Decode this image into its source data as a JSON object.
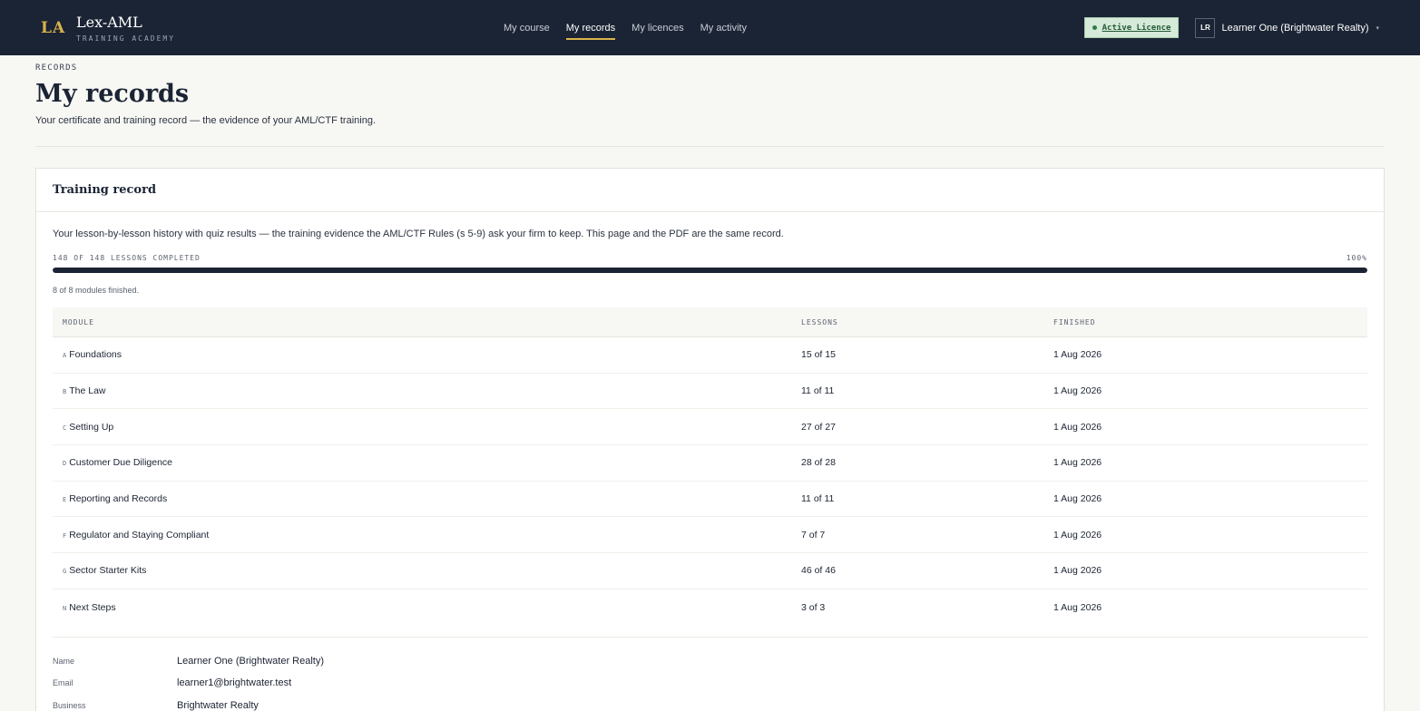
{
  "brand": {
    "mark": "LA",
    "name": "Lex-AML",
    "subtitle": "TRAINING ACADEMY"
  },
  "nav": [
    {
      "label": "My course",
      "active": false
    },
    {
      "label": "My records",
      "active": true
    },
    {
      "label": "My licences",
      "active": false
    },
    {
      "label": "My activity",
      "active": false
    }
  ],
  "licence_badge": {
    "label": "Active Licence",
    "color": "#2f7a46"
  },
  "user": {
    "initials": "LR",
    "name": "Learner One (Brightwater Realty)",
    "caret": "▾"
  },
  "page": {
    "eyebrow": "RECORDS",
    "title": "My records",
    "subtitle": "Your certificate and training record — the evidence of your AML/CTF training."
  },
  "training_record": {
    "title": "Training record",
    "intro": "Your lesson-by-lesson history with quiz results — the training evidence the AML/CTF Rules (s 5-9) ask your firm to keep. This page and the PDF are the same record.",
    "progress_label": "148 OF 148 LESSONS COMPLETED",
    "progress_pct": "100%",
    "progress_fraction": 1.0,
    "modules_note": "8 of 8 modules finished.",
    "columns": {
      "module": "MODULE",
      "lessons": "LESSONS",
      "finished": "FINISHED"
    },
    "rows": [
      {
        "letter": "A",
        "module": "Foundations",
        "lessons": "15 of 15",
        "finished": "1 Aug 2026"
      },
      {
        "letter": "B",
        "module": "The Law",
        "lessons": "11 of 11",
        "finished": "1 Aug 2026"
      },
      {
        "letter": "C",
        "module": "Setting Up",
        "lessons": "27 of 27",
        "finished": "1 Aug 2026"
      },
      {
        "letter": "D",
        "module": "Customer Due Diligence",
        "lessons": "28 of 28",
        "finished": "1 Aug 2026"
      },
      {
        "letter": "E",
        "module": "Reporting and Records",
        "lessons": "11 of 11",
        "finished": "1 Aug 2026"
      },
      {
        "letter": "F",
        "module": "Regulator and Staying Compliant",
        "lessons": "7 of 7",
        "finished": "1 Aug 2026"
      },
      {
        "letter": "G",
        "module": "Sector Starter Kits",
        "lessons": "46 of 46",
        "finished": "1 Aug 2026"
      },
      {
        "letter": "N",
        "module": "Next Steps",
        "lessons": "3 of 3",
        "finished": "1 Aug 2026"
      }
    ],
    "details": [
      {
        "key": "Name",
        "value": "Learner One (Brightwater Realty)"
      },
      {
        "key": "Email",
        "value": "learner1@brightwater.test"
      },
      {
        "key": "Business",
        "value": "Brightwater Realty"
      }
    ]
  }
}
